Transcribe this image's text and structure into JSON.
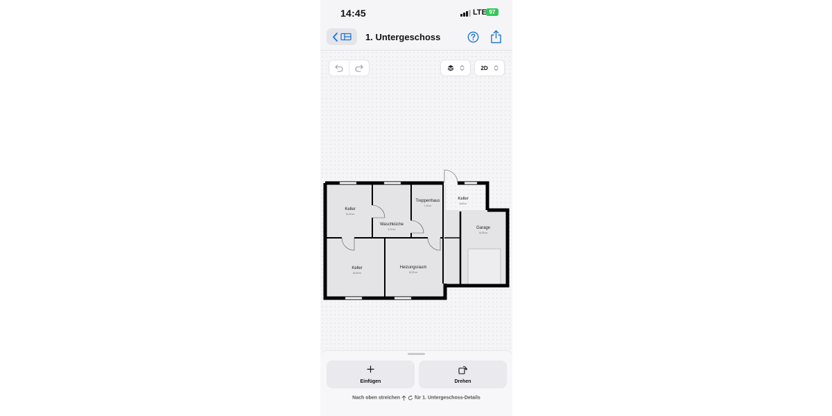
{
  "status_bar": {
    "time": "14:45",
    "network": "LTE",
    "battery": "97"
  },
  "nav": {
    "title": "1. Untergeschoss"
  },
  "toolbar": {
    "view_mode": "2D"
  },
  "rooms": [
    {
      "name": "Keller",
      "area": "10,23 m²"
    },
    {
      "name": "Waschküche",
      "area": "6,74 m²"
    },
    {
      "name": "Treppenhaus",
      "area": "7,15 m²"
    },
    {
      "name": "Keller",
      "area": "6,65 m²"
    },
    {
      "name": "Garage",
      "area": "14,05 m²"
    },
    {
      "name": "Keller",
      "area": "15,09 m²"
    },
    {
      "name": "Heizungsraum",
      "area": "15,25 m²"
    }
  ],
  "bottom_sheet": {
    "insert_label": "Einfügen",
    "rotate_label": "Drehen",
    "hint_prefix": "Nach oben streichen",
    "hint_suffix": "für 1. Untergeschoss-Details"
  },
  "colors": {
    "accent": "#1c74d9",
    "battery": "#34c759",
    "room_fill": "#e4e4e6",
    "wall": "#000000"
  },
  "icons": [
    "chevron-left-icon",
    "floors-icon",
    "help-icon",
    "share-icon",
    "undo-icon",
    "redo-icon",
    "layers-icon",
    "chevron-updown-icon",
    "plus-icon",
    "rotate-icon"
  ]
}
